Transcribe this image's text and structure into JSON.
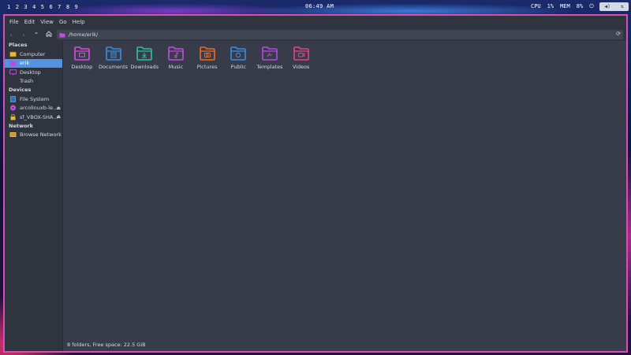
{
  "topbar": {
    "workspaces": [
      "1",
      "2",
      "3",
      "4",
      "5",
      "6",
      "7",
      "8",
      "9"
    ],
    "clock": "06:49 AM",
    "cpu_label": "CPU",
    "cpu_value": "1%",
    "mem_label": "MEM",
    "mem_value": "8%",
    "lock_glyph": "⏻"
  },
  "menubar": {
    "items": [
      "File",
      "Edit",
      "View",
      "Go",
      "Help"
    ]
  },
  "toolbar": {
    "path": "/home/erik/"
  },
  "sidebar": {
    "places_heading": "Places",
    "places": [
      {
        "label": "Computer",
        "icon": "computer-icon"
      },
      {
        "label": "erik",
        "icon": "home-icon",
        "selected": true
      },
      {
        "label": "Desktop",
        "icon": "desktop-icon"
      },
      {
        "label": "Trash",
        "icon": "trash-icon"
      }
    ],
    "devices_heading": "Devices",
    "devices": [
      {
        "label": "File System",
        "icon": "filesystem-icon"
      },
      {
        "label": "arcolinuxb-le...",
        "icon": "disc-icon",
        "eject": true
      },
      {
        "label": "sf_VBOX-SHA...",
        "icon": "lock-drive-icon",
        "eject": true
      }
    ],
    "network_heading": "Network",
    "network": [
      {
        "label": "Browse Network",
        "icon": "network-icon"
      }
    ]
  },
  "folders": [
    {
      "label": "Desktop",
      "icon": "folder-desktop-icon",
      "color": "#d94de0"
    },
    {
      "label": "Documents",
      "icon": "folder-documents-icon",
      "color": "#3b8fe0"
    },
    {
      "label": "Downloads",
      "icon": "folder-downloads-icon",
      "color": "#2fc0a0"
    },
    {
      "label": "Music",
      "icon": "folder-music-icon",
      "color": "#c44de0"
    },
    {
      "label": "Pictures",
      "icon": "folder-pictures-icon",
      "color": "#f06a24"
    },
    {
      "label": "Public",
      "icon": "folder-public-icon",
      "color": "#3b8fe0"
    },
    {
      "label": "Templates",
      "icon": "folder-templates-icon",
      "color": "#b04de0"
    },
    {
      "label": "Videos",
      "icon": "folder-videos-icon",
      "color": "#e0458c"
    }
  ],
  "statusbar": {
    "text": "8 folders, Free space: 22.5 GiB"
  },
  "colors": {
    "window_border": "#d252b2",
    "selection": "#5294e2",
    "background": "#383c4a",
    "sidebar": "#2f343f"
  }
}
